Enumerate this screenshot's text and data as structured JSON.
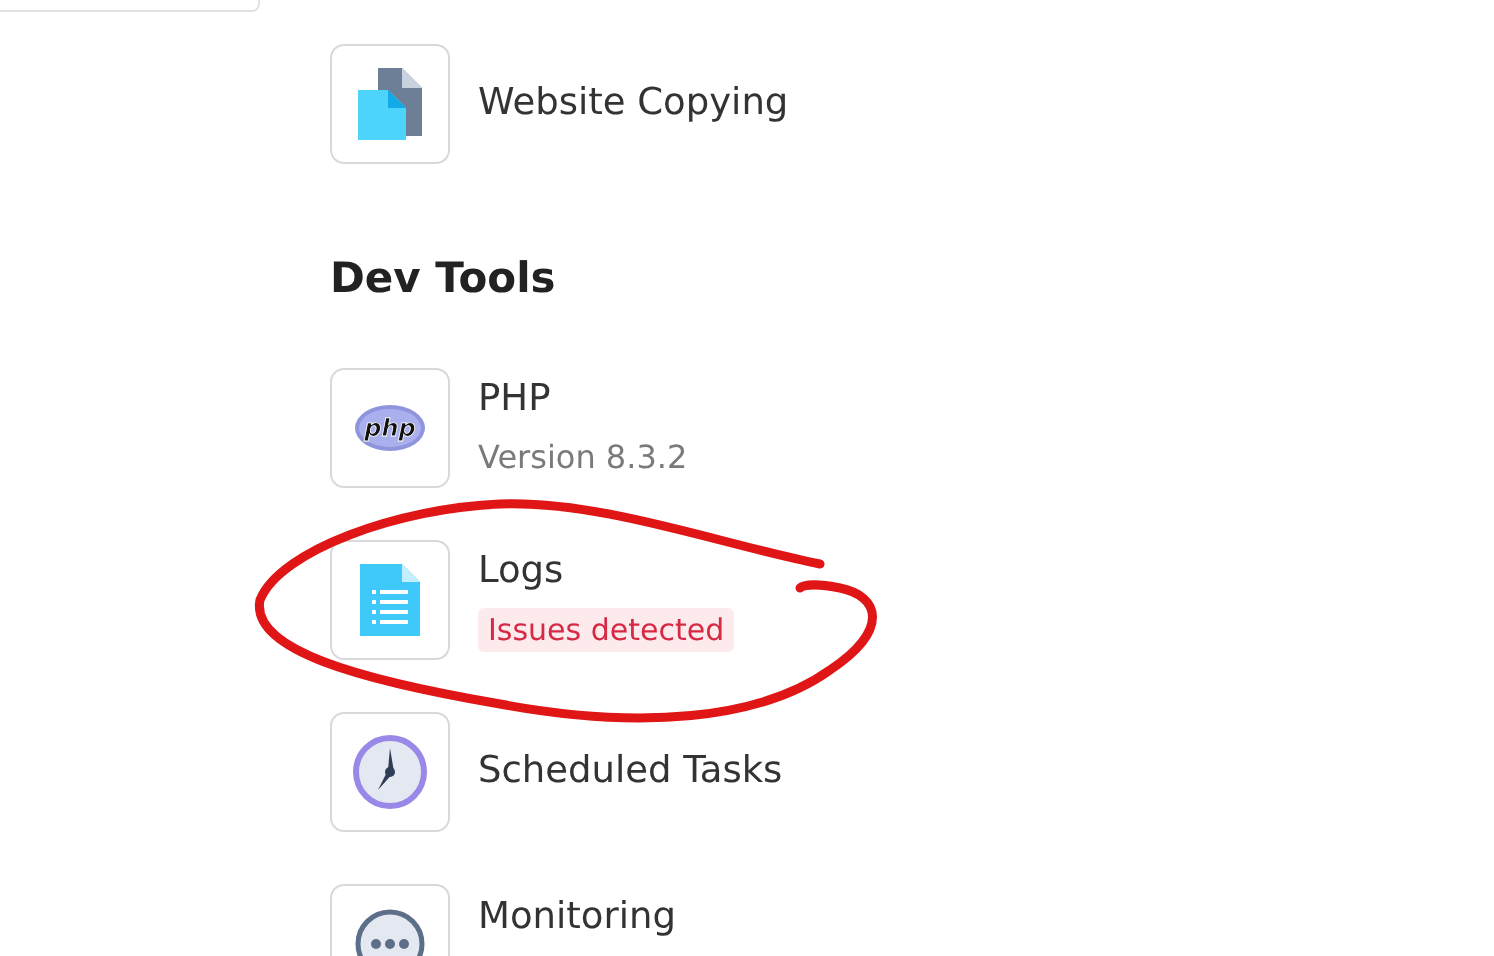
{
  "sections": [
    {
      "items": [
        {
          "title": "Website Copying"
        }
      ]
    },
    {
      "heading": "Dev Tools",
      "items": [
        {
          "title": "PHP",
          "logo_text": "php",
          "subtitle": {
            "kind": "muted",
            "text": "Version 8.3.2"
          }
        },
        {
          "title": "Logs",
          "subtitle": {
            "kind": "alert",
            "text": "Issues detected"
          }
        },
        {
          "title": "Scheduled Tasks"
        },
        {
          "title": "Monitoring"
        }
      ]
    }
  ]
}
